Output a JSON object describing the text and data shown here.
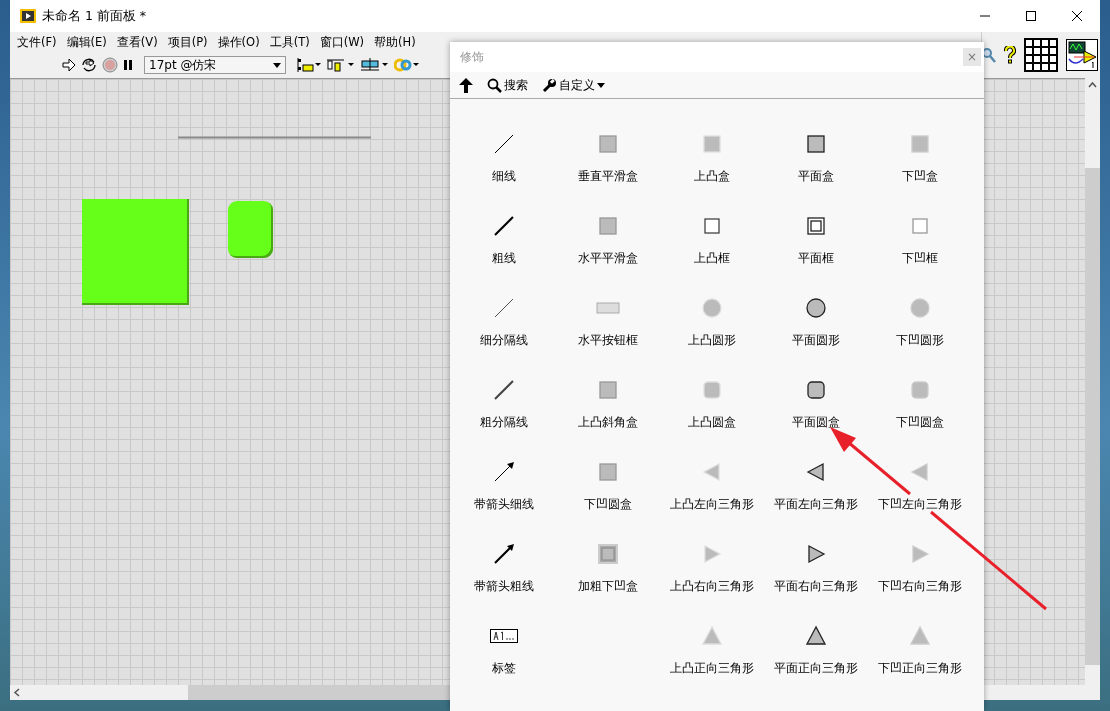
{
  "window": {
    "title": "未命名 1 前面板 *"
  },
  "menu": [
    "文件(F)",
    "编辑(E)",
    "查看(V)",
    "项目(P)",
    "操作(O)",
    "工具(T)",
    "窗口(W)",
    "帮助(H)"
  ],
  "toolbar": {
    "font": "17pt @仿宋"
  },
  "palette": {
    "title": "修饰",
    "close": "×",
    "search": "搜索",
    "customize": "自定义",
    "items": [
      {
        "label": "细线",
        "kind": "line"
      },
      {
        "label": "垂直平滑盒",
        "kind": "smoothbox"
      },
      {
        "label": "上凸盒",
        "kind": "raisedbox"
      },
      {
        "label": "平面盒",
        "kind": "flatbox"
      },
      {
        "label": "下凹盒",
        "kind": "loweredbox"
      },
      {
        "label": "粗线",
        "kind": "thickline"
      },
      {
        "label": "水平平滑盒",
        "kind": "smoothbox"
      },
      {
        "label": "上凸框",
        "kind": "raisedframe"
      },
      {
        "label": "平面框",
        "kind": "flatframe"
      },
      {
        "label": "下凹框",
        "kind": "loweredframe"
      },
      {
        "label": "细分隔线",
        "kind": "divider"
      },
      {
        "label": "水平按钮框",
        "kind": "buttonframe"
      },
      {
        "label": "上凸圆形",
        "kind": "raisedcircle"
      },
      {
        "label": "平面圆形",
        "kind": "flatcircle"
      },
      {
        "label": "下凹圆形",
        "kind": "loweredcircle"
      },
      {
        "label": "粗分隔线",
        "kind": "thickdivider"
      },
      {
        "label": "上凸斜角盒",
        "kind": "smoothbox"
      },
      {
        "label": "上凸圆盒",
        "kind": "raisedroundbox"
      },
      {
        "label": "平面圆盒",
        "kind": "flatroundbox"
      },
      {
        "label": "下凹圆盒",
        "kind": "loweredroundbox"
      },
      {
        "label": "带箭头细线",
        "kind": "arrowline"
      },
      {
        "label": "下凹圆盒",
        "kind": "smoothbox"
      },
      {
        "label": "上凸左向三角形",
        "kind": "raisedleft"
      },
      {
        "label": "平面左向三角形",
        "kind": "flatleft"
      },
      {
        "label": "下凹左向三角形",
        "kind": "loweredleft"
      },
      {
        "label": "带箭头粗线",
        "kind": "thickarrowline"
      },
      {
        "label": "加粗下凹盒",
        "kind": "thickbox"
      },
      {
        "label": "上凸右向三角形",
        "kind": "raisedright"
      },
      {
        "label": "平面右向三角形",
        "kind": "flatright"
      },
      {
        "label": "下凹右向三角形",
        "kind": "loweredright"
      },
      {
        "label": "标签",
        "kind": "label"
      },
      {
        "kind": "blank"
      },
      {
        "label": "上凸正向三角形",
        "kind": "raisedup"
      },
      {
        "label": "平面正向三角形",
        "kind": "flatup"
      },
      {
        "label": "下凹正向三角形",
        "kind": "loweredup"
      }
    ]
  }
}
